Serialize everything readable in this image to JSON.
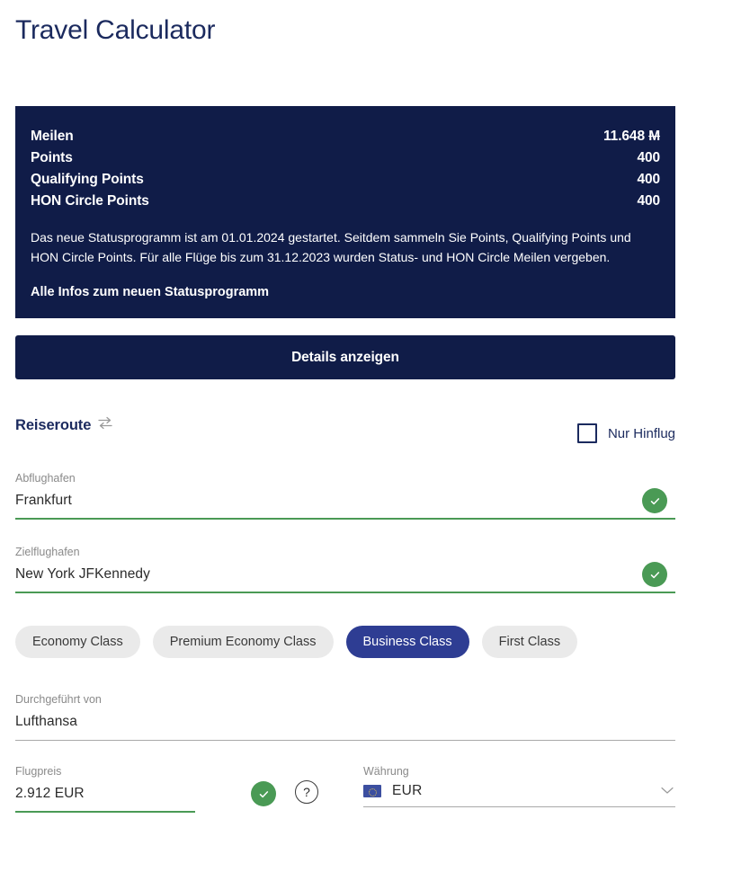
{
  "page": {
    "title": "Travel Calculator"
  },
  "status_card": {
    "stats": [
      {
        "label": "Meilen",
        "value": "11.648",
        "unit": "M",
        "unit_struck": true
      },
      {
        "label": "Points",
        "value": "400",
        "unit": "",
        "unit_struck": false
      },
      {
        "label": "Qualifying Points",
        "value": "400",
        "unit": "",
        "unit_struck": false
      },
      {
        "label": "HON Circle Points",
        "value": "400",
        "unit": "",
        "unit_struck": false
      }
    ],
    "paragraph": "Das neue Statusprogramm ist am 01.01.2024 gestartet. Seitdem sammeln Sie Points, Qualifying Points und HON Circle Points. Für alle Flüge bis zum 31.12.2023 wurden Status- und HON Circle Meilen vergeben.",
    "link_label": "Alle Infos zum neuen Statusprogramm",
    "background_color": "#101c48"
  },
  "details_button": {
    "label": "Details anzeigen"
  },
  "route_section": {
    "heading": "Reiseroute",
    "swap_icon": "swap-arrows-icon",
    "oneway": {
      "label": "Nur Hinflug",
      "checked": false
    },
    "departure": {
      "label": "Abflughafen",
      "value": "Frankfurt",
      "placeholder": "Abflughafen",
      "valid": true
    },
    "destination": {
      "label": "Zielflughafen",
      "value": "New York JFKennedy",
      "placeholder": "Zielflughafen",
      "valid": true
    }
  },
  "travel_classes": {
    "options": [
      {
        "label": "Economy Class",
        "selected": false
      },
      {
        "label": "Premium Economy Class",
        "selected": false
      },
      {
        "label": "Business Class",
        "selected": true
      },
      {
        "label": "First Class",
        "selected": false
      }
    ],
    "selected_color": "#2e3d93"
  },
  "operator": {
    "label": "Durchgeführt von",
    "value": "Lufthansa",
    "placeholder": "Durchgeführt von"
  },
  "fare": {
    "label": "Flugpreis",
    "value": "2.912 EUR",
    "placeholder": "Flugpreis",
    "valid": true,
    "help_icon_label": "?"
  },
  "currency": {
    "label": "Währung",
    "value": "EUR",
    "flag_icon": "eu-flag-icon",
    "chevron_icon": "chevron-down-icon"
  },
  "colors": {
    "navy": "#101c48",
    "title_navy": "#1b2a5e",
    "valid_green": "#4a9a55",
    "pill_grey": "#eaeaea",
    "label_grey": "#8a8a8a"
  }
}
